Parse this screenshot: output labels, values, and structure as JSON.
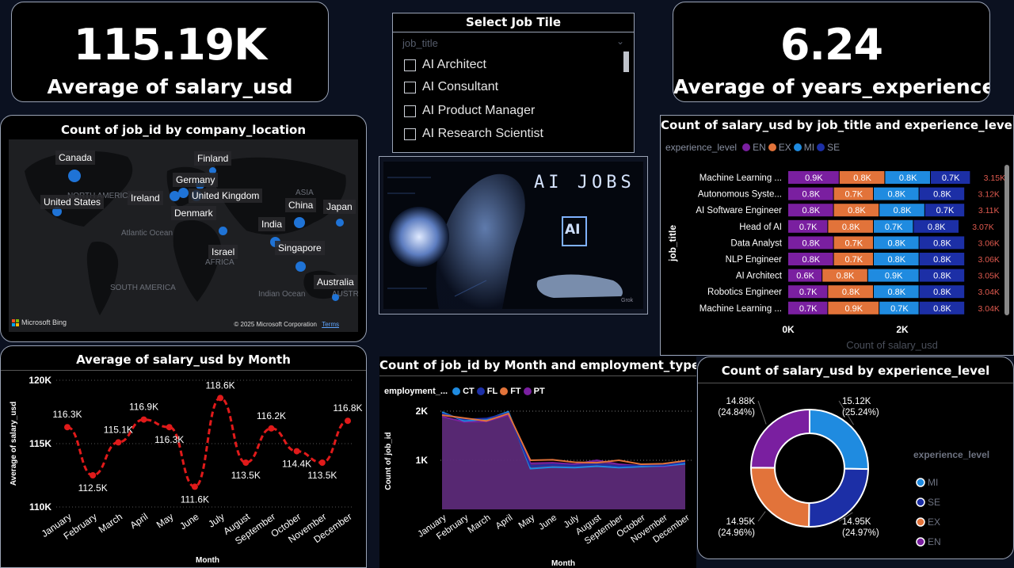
{
  "kpi_salary": {
    "value": "115.19K",
    "label": "Average of salary_usd"
  },
  "kpi_exp": {
    "value": "6.24",
    "label": "Average of years_experience"
  },
  "slicer": {
    "title": "Select Job Tile",
    "field": "job_title",
    "items": [
      "AI Architect",
      "AI Consultant",
      "AI Product Manager",
      "AI Research Scientist"
    ]
  },
  "map": {
    "title": "Count of job_id by company_location",
    "countries": [
      "Canada",
      "Finland",
      "Germany",
      "Ireland",
      "United Kingdom",
      "United States",
      "Denmark",
      "China",
      "Japan",
      "India",
      "Israel",
      "Singapore",
      "Australia"
    ],
    "geo_labels": [
      "NORTH AMERICA",
      "Atlantic Ocean",
      "ASIA",
      "AFRICA",
      "SOUTH AMERICA",
      "Indian Ocean",
      "AUSTR"
    ],
    "bing": "Microsoft Bing",
    "copyright": "© 2025 Microsoft Corporation",
    "terms": "Terms"
  },
  "ai_image": {
    "headline": "AI JOBS",
    "chip": "AI",
    "watermark": "Grok"
  },
  "colors": {
    "EN": "#7a1fa0",
    "EX": "#e2733a",
    "MI": "#1f8be0",
    "SE": "#1c2fa6",
    "CT": "#1f8be0",
    "FL": "#1c2fa6",
    "FT": "#e2733a",
    "PT": "#7a1fa0",
    "line": "#e01a1a"
  },
  "chart_data": [
    {
      "type": "line",
      "title": "Average of salary_usd by Month",
      "xlabel": "Month",
      "ylabel": "Average of salary_usd",
      "ylim": [
        110000,
        120000
      ],
      "yticks": [
        "110K",
        "115K",
        "120K"
      ],
      "categories": [
        "January",
        "February",
        "March",
        "April",
        "May",
        "June",
        "July",
        "August",
        "September",
        "October",
        "November",
        "December"
      ],
      "values": [
        116300,
        112500,
        115100,
        116900,
        116300,
        111600,
        118600,
        113500,
        116200,
        114400,
        113500,
        116800
      ],
      "labels": [
        "116.3K",
        "112.5K",
        "115.1K",
        "116.9K",
        "116.3K",
        "111.6K",
        "118.6K",
        "113.5K",
        "116.2K",
        "114.4K",
        "113.5K",
        "116.8K"
      ]
    },
    {
      "type": "bar",
      "orientation": "horizontal-stacked",
      "title": "Count of salary_usd by job_title and experience_level",
      "xlabel": "Count of salary_usd",
      "ylabel": "job_title",
      "legend_title": "experience_level",
      "xticks": [
        "0K",
        "2K"
      ],
      "xlim": [
        0,
        4500
      ],
      "categories": [
        "Machine Learning ...",
        "Autonomous Syste...",
        "AI Software Engineer",
        "Head of AI",
        "Data Analyst",
        "NLP Engineer",
        "AI Architect",
        "Robotics Engineer",
        "Machine Learning ..."
      ],
      "series": [
        {
          "name": "EN",
          "values": [
            900,
            800,
            800,
            700,
            800,
            800,
            600,
            700,
            700
          ],
          "labels": [
            "0.9K",
            "0.8K",
            "0.8K",
            "0.7K",
            "0.8K",
            "0.8K",
            "0.6K",
            "0.7K",
            "0.7K"
          ]
        },
        {
          "name": "EX",
          "values": [
            800,
            700,
            800,
            800,
            700,
            700,
            800,
            800,
            900
          ],
          "labels": [
            "0.8K",
            "0.7K",
            "0.8K",
            "0.8K",
            "0.7K",
            "0.7K",
            "0.8K",
            "0.8K",
            "0.9K"
          ]
        },
        {
          "name": "MI",
          "values": [
            800,
            800,
            800,
            700,
            800,
            800,
            900,
            800,
            700
          ],
          "labels": [
            "0.8K",
            "0.8K",
            "0.8K",
            "0.7K",
            "0.8K",
            "0.8K",
            "0.9K",
            "0.8K",
            "0.7K"
          ]
        },
        {
          "name": "SE",
          "values": [
            700,
            800,
            700,
            800,
            800,
            800,
            800,
            800,
            800
          ],
          "labels": [
            "0.7K",
            "0.8K",
            "0.7K",
            "0.8K",
            "0.8K",
            "0.8K",
            "0.8K",
            "0.8K",
            "0.8K"
          ]
        }
      ],
      "totals": [
        "3.15K",
        "3.12K",
        "3.11K",
        "3.07K",
        "3.06K",
        "3.06K",
        "3.05K",
        "3.04K",
        "3.04K"
      ]
    },
    {
      "type": "area",
      "title": "Count of job_id by Month and employment_type",
      "xlabel": "Month",
      "ylabel": "Count of job_id",
      "legend_title": "employment_...",
      "ylim": [
        0,
        2300
      ],
      "yticks": [
        "1K",
        "2K"
      ],
      "categories": [
        "January",
        "February",
        "March",
        "April",
        "May",
        "June",
        "July",
        "August",
        "September",
        "October",
        "November",
        "December"
      ],
      "series": [
        {
          "name": "CT",
          "values": [
            1980,
            1800,
            1830,
            1990,
            830,
            860,
            850,
            880,
            850,
            870,
            890,
            930
          ]
        },
        {
          "name": "FL",
          "values": [
            1950,
            1830,
            1850,
            1960,
            880,
            910,
            890,
            920,
            880,
            900,
            900,
            960
          ]
        },
        {
          "name": "FT",
          "values": [
            1920,
            1860,
            1800,
            1950,
            1000,
            1010,
            960,
            950,
            1000,
            920,
            930,
            990
          ]
        },
        {
          "name": "PT",
          "values": [
            1890,
            1780,
            1790,
            1920,
            940,
            950,
            920,
            1000,
            920,
            890,
            870,
            930
          ]
        }
      ]
    },
    {
      "type": "pie",
      "style": "donut",
      "title": "Count of salary_usd by experience_level",
      "legend_title": "experience_level",
      "categories": [
        "MI",
        "SE",
        "EX",
        "EN"
      ],
      "values": [
        15120,
        14950,
        14950,
        14880
      ],
      "labels": [
        "15.12K\n(25.24%)",
        "14.95K\n(24.97%)",
        "14.95K\n(24.96%)",
        "14.88K\n(24.84%)"
      ]
    }
  ]
}
